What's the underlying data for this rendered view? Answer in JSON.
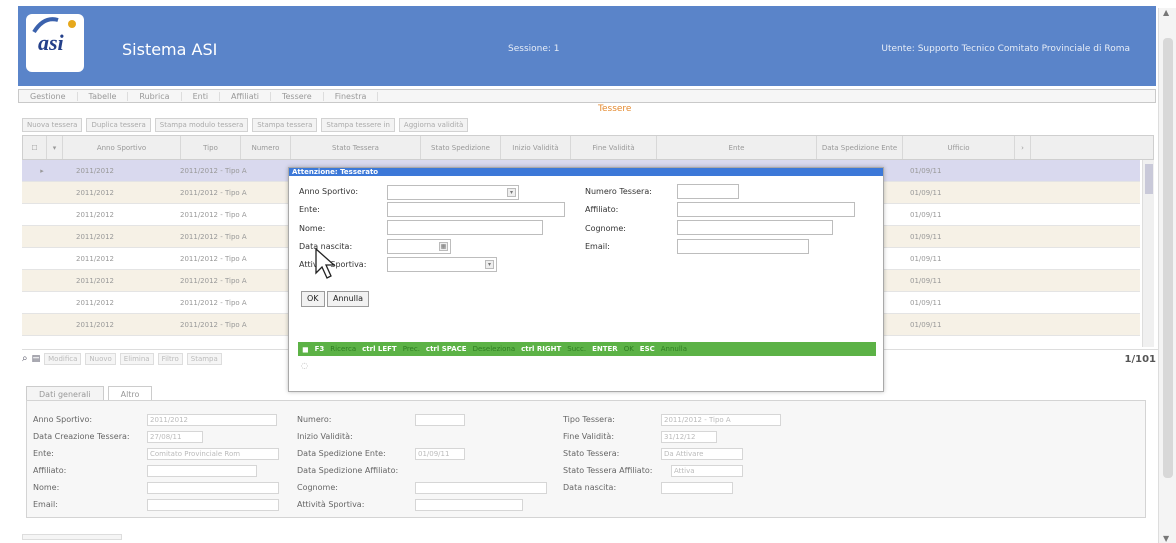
{
  "header": {
    "app_title": "Sistema ASI",
    "session": "Sessione: 1",
    "user": "Utente: Supporto Tecnico Comitato Provinciale di Roma",
    "logo_text": "asi"
  },
  "menu": [
    "Gestione",
    "Tabelle",
    "Rubrica",
    "Enti",
    "Affiliati",
    "Tessere",
    "Finestra"
  ],
  "section_title": "Tessere",
  "toolbar": [
    "Nuova tessera",
    "Duplica tessera",
    "Stampa modulo tessera",
    "Stampa tessera",
    "Stampa tessere in",
    "Aggiorna validità"
  ],
  "grid": {
    "columns": [
      "",
      "",
      "Anno Sportivo",
      "Tipo",
      "Numero",
      "Stato Tessera",
      "Stato Spedizione",
      "Inizio Validità",
      "Fine Validità",
      "Ente",
      "Data Spedizione Ente",
      "Ufficio"
    ],
    "rows": [
      {
        "anno": "2011/2012",
        "tipo": "2011/2012 - Tipo A",
        "spedizione": "01/09/11"
      },
      {
        "anno": "2011/2012",
        "tipo": "2011/2012 - Tipo A",
        "spedizione": "01/09/11"
      },
      {
        "anno": "2011/2012",
        "tipo": "2011/2012 - Tipo A",
        "spedizione": "01/09/11"
      },
      {
        "anno": "2011/2012",
        "tipo": "2011/2012 - Tipo A",
        "spedizione": "01/09/11"
      },
      {
        "anno": "2011/2012",
        "tipo": "2011/2012 - Tipo A",
        "spedizione": "01/09/11"
      },
      {
        "anno": "2011/2012",
        "tipo": "2011/2012 - Tipo A",
        "spedizione": "01/09/11"
      },
      {
        "anno": "2011/2012",
        "tipo": "2011/2012 - Tipo A",
        "spedizione": "01/09/11"
      },
      {
        "anno": "2011/2012",
        "tipo": "2011/2012 - Tipo A",
        "spedizione": "01/09/11"
      }
    ],
    "footer_buttons": [
      "Modifica",
      "Nuovo",
      "Elimina",
      "Filtro",
      "Stampa"
    ],
    "pager": "1/101"
  },
  "tabs": [
    "Dati generali",
    "Altro"
  ],
  "details": {
    "anno_label": "Anno Sportivo:",
    "anno_value": "2011/2012",
    "creazione_label": "Data Creazione Tessera:",
    "creazione_value": "27/08/11",
    "ente_label": "Ente:",
    "ente_value": "Comitato Provinciale Rom",
    "affiliato_label": "Affiliato:",
    "nome_label": "Nome:",
    "email_label": "Email:",
    "numero_label": "Numero:",
    "inizio_label": "Inizio Validità:",
    "spedizione_ente_label": "Data Spedizione Ente:",
    "spedizione_ente_value": "01/09/11",
    "spedizione_affiliato_label": "Data Spedizione Affiliato:",
    "cognome_label": "Cognome:",
    "attivita_label": "Attività Sportiva:",
    "tipo_label": "Tipo Tessera:",
    "tipo_value": "2011/2012 - Tipo A",
    "fine_label": "Fine Validità:",
    "fine_value": "31/12/12",
    "stato_label": "Stato Tessera:",
    "stato_value": "Da Attivare",
    "stato_affiliato_label": "Stato Tessera Affiliato:",
    "stato_affiliato_value": "Attiva",
    "nascita_label": "Data nascita:"
  },
  "modal": {
    "title": "Attenzione: Tesserato",
    "anno_label": "Anno Sportivo:",
    "ente_label": "Ente:",
    "nome_label": "Nome:",
    "nascita_label": "Data nascita:",
    "attivita_label": "Attività Sportiva:",
    "numero_label": "Numero Tessera:",
    "affiliato_label": "Affiliato:",
    "cognome_label": "Cognome:",
    "email_label": "Email:",
    "ok_label": "OK",
    "annulla_label": "Annulla",
    "shortcuts": [
      {
        "key": "F3",
        "action": "Ricerca"
      },
      {
        "key": "ctrl LEFT",
        "action": "Prec."
      },
      {
        "key": "ctrl SPACE",
        "action": "Deseleziona"
      },
      {
        "key": "ctrl RIGHT",
        "action": "Succ."
      },
      {
        "key": "ENTER",
        "action": "OK"
      },
      {
        "key": "ESC",
        "action": "Annulla"
      }
    ]
  }
}
